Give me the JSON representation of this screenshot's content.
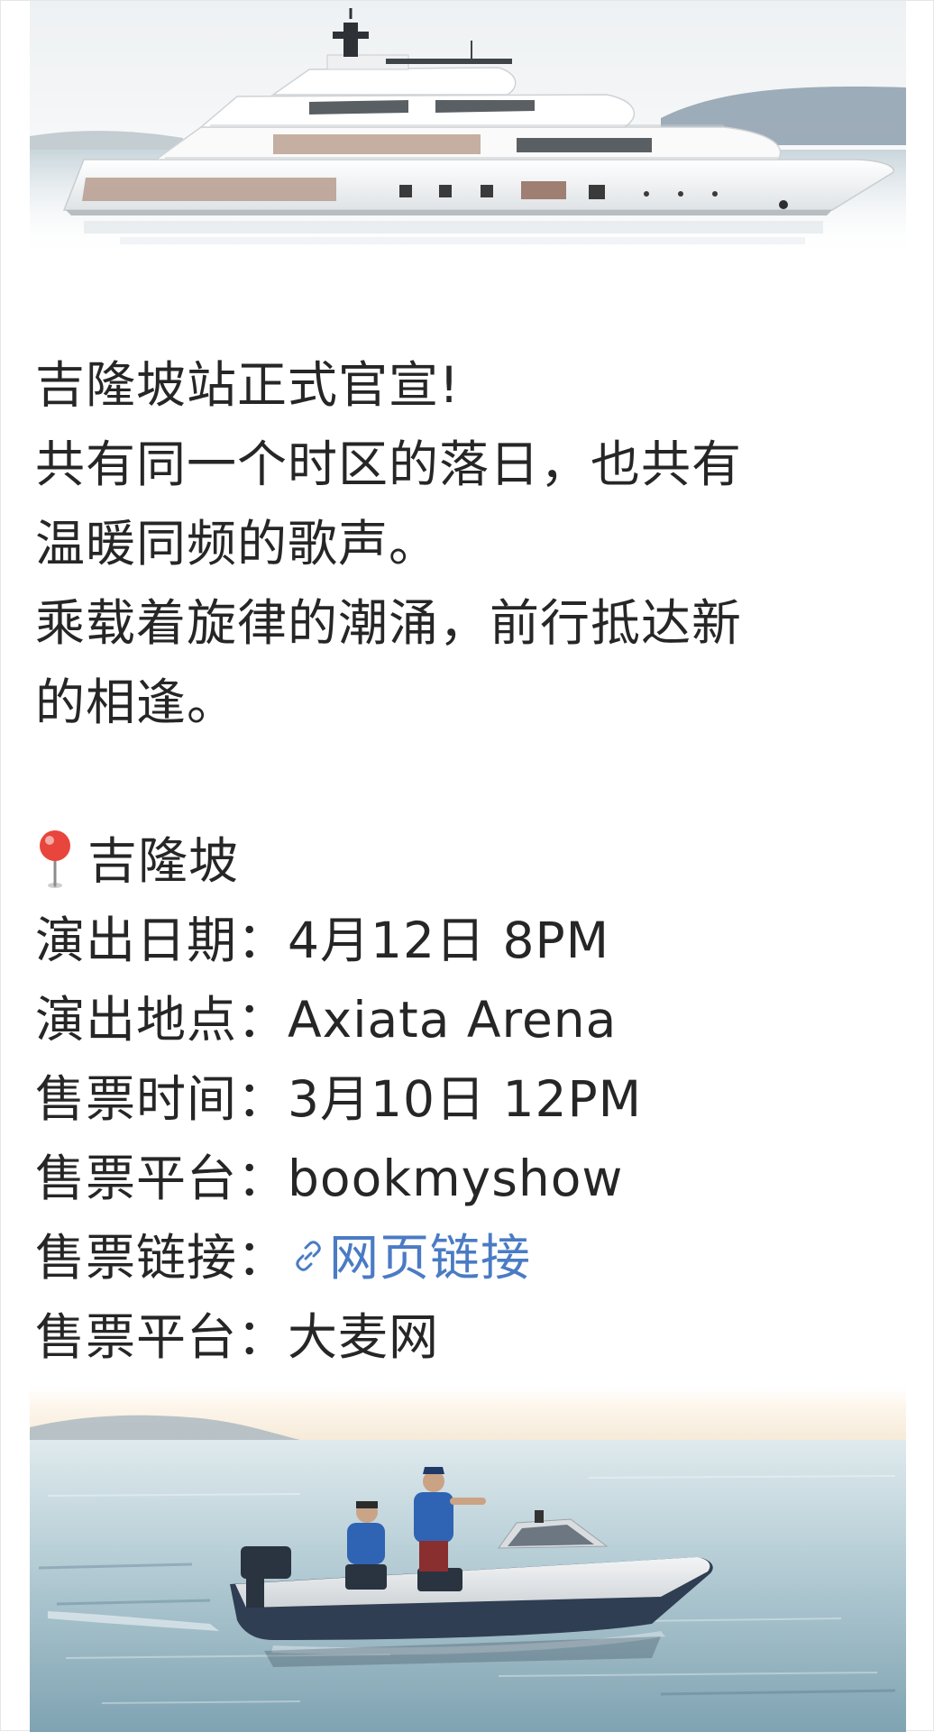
{
  "post": {
    "title": "吉隆坡站正式官宣!",
    "lines": [
      "共有同一个时区的落日，也共有",
      "温暖同频的歌声。",
      "乘载着旋律的潮涌，前行抵达新",
      "的相逢。"
    ],
    "location": {
      "icon": "pin-icon",
      "name": "吉隆坡"
    },
    "details": {
      "date_label": "演出日期：",
      "date_value": "4月12日 8PM",
      "venue_label": "演出地点：",
      "venue_value": "Axiata Arena",
      "sale_time_label": "售票时间：",
      "sale_time_value": "3月10日 12PM",
      "platform_label": "售票平台：",
      "platform_value": "bookmyshow",
      "link_label": "售票链接：",
      "link_text": "网页链接",
      "link_icon": "link-icon",
      "platform2_label": "售票平台：",
      "platform2_value": "大麦网"
    }
  },
  "images": {
    "top": "yacht-image",
    "bottom": "speedboat-image"
  },
  "colors": {
    "text": "#262626",
    "link": "#4a7bc4",
    "pin": "#e8453c"
  }
}
